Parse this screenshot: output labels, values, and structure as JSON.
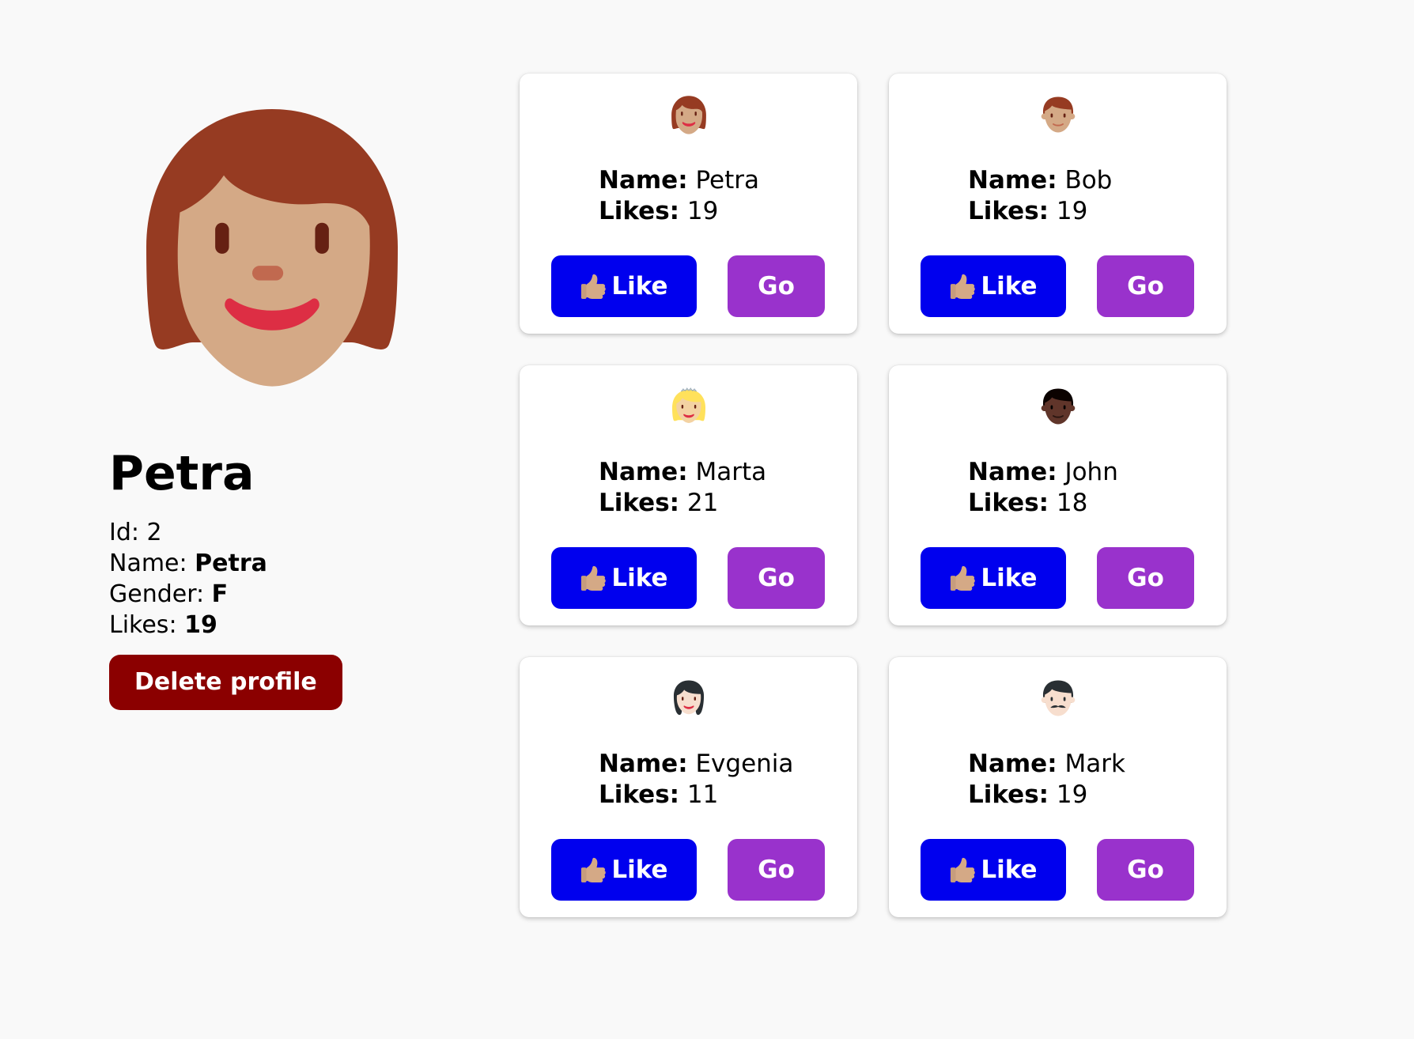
{
  "profile": {
    "name": "Petra",
    "avatar_icon": "woman-red-hair-medium-light-skin-icon",
    "id_label": "Id: ",
    "id_value": "2",
    "name_label": "Name: ",
    "name_value": "Petra",
    "gender_label": "Gender: ",
    "gender_value": "F",
    "likes_label": "Likes: ",
    "likes_value": "19",
    "delete_label": "Delete profile"
  },
  "cards": [
    {
      "name_label": "Name:",
      "name": "Petra",
      "likes_label": "Likes:",
      "likes": "19",
      "like_label": "Like",
      "go_label": "Go",
      "avatar_icon": "woman-red-hair-icon"
    },
    {
      "name_label": "Name:",
      "name": "Bob",
      "likes_label": "Likes:",
      "likes": "19",
      "like_label": "Like",
      "go_label": "Go",
      "avatar_icon": "man-red-hair-icon"
    },
    {
      "name_label": "Name:",
      "name": "Marta",
      "likes_label": "Likes:",
      "likes": "21",
      "like_label": "Like",
      "go_label": "Go",
      "avatar_icon": "blonde-woman-tiara-icon"
    },
    {
      "name_label": "Name:",
      "name": "John",
      "likes_label": "Likes:",
      "likes": "18",
      "like_label": "Like",
      "go_label": "Go",
      "avatar_icon": "man-dark-skin-icon"
    },
    {
      "name_label": "Name:",
      "name": "Evgenia",
      "likes_label": "Likes:",
      "likes": "11",
      "like_label": "Like",
      "go_label": "Go",
      "avatar_icon": "woman-black-hair-icon"
    },
    {
      "name_label": "Name:",
      "name": "Mark",
      "likes_label": "Likes:",
      "likes": "19",
      "like_label": "Like",
      "go_label": "Go",
      "avatar_icon": "man-mustache-icon"
    }
  ],
  "colors": {
    "like_button": "#0000ee",
    "go_button": "#9932cc",
    "delete_button": "#8b0000",
    "background": "#f9f9f9"
  }
}
